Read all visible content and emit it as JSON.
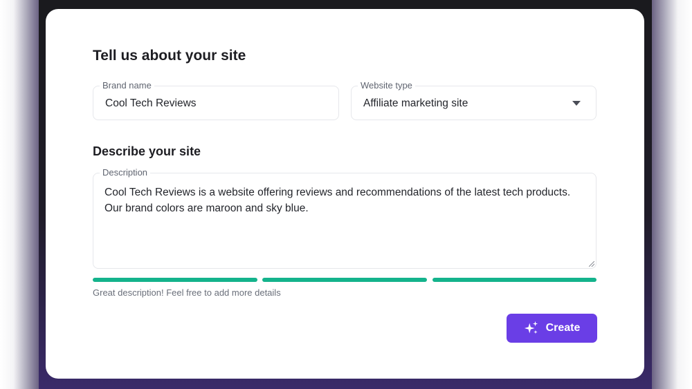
{
  "form": {
    "section_title": "Tell us about your site",
    "brand": {
      "label": "Brand name",
      "value": "Cool Tech Reviews"
    },
    "website_type": {
      "label": "Website type",
      "value": "Affiliate marketing site",
      "icon": "chevron-down-icon"
    },
    "describe_title": "Describe your site",
    "description": {
      "label": "Description",
      "value": "Cool Tech Reviews is a website offering reviews and recommendations of the latest tech products. Our brand colors are maroon and sky blue."
    },
    "strength": {
      "segments_filled": 3,
      "segments_total": 3,
      "color": "#14b38c"
    },
    "hint": "Great description! Feel free to add more details",
    "create_button": {
      "label": "Create",
      "icon": "sparkles-icon",
      "color": "#6a3ee6"
    }
  }
}
